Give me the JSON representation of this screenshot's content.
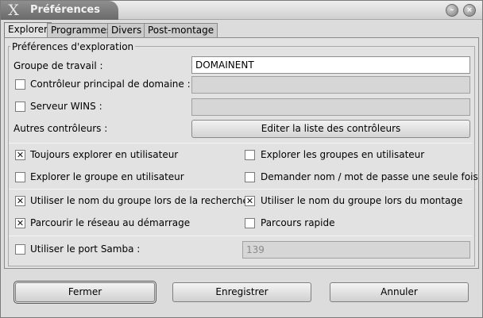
{
  "window": {
    "title": "Préférences",
    "icon": "x-icon",
    "controls": [
      "minimize-icon",
      "close-icon"
    ]
  },
  "tabs": [
    {
      "label": "Explorer",
      "active": true
    },
    {
      "label": "Programmes",
      "active": false
    },
    {
      "label": "Divers",
      "active": false
    },
    {
      "label": "Post-montage",
      "active": false
    }
  ],
  "group": {
    "title": "Préférences d'exploration"
  },
  "workgroup": {
    "label": "Groupe de travail :",
    "value": "DOMAINENT"
  },
  "pdc": {
    "label": "Contrôleur principal de domaine :",
    "checked": false,
    "value": ""
  },
  "wins": {
    "label": "Serveur WINS :",
    "checked": false,
    "value": ""
  },
  "other_controllers": {
    "label": "Autres contrôleurs :",
    "button": "Editer la liste des contrôleurs"
  },
  "options": {
    "always_browse_user": {
      "label": "Toujours explorer en utilisateur",
      "checked": true
    },
    "browse_groups_user": {
      "label": "Explorer les groupes en utilisateur",
      "checked": false
    },
    "browse_group_user": {
      "label": "Explorer le groupe en utilisateur",
      "checked": false
    },
    "ask_password_once": {
      "label": "Demander nom / mot de passe une seule fois",
      "checked": false
    },
    "use_group_name_search": {
      "label": "Utiliser le nom du groupe lors de la recherche",
      "checked": true
    },
    "use_group_name_mount": {
      "label": "Utiliser le nom du groupe lors du montage",
      "checked": true
    },
    "scan_network_startup": {
      "label": "Parcourir le réseau au démarrage",
      "checked": true
    },
    "quick_scan": {
      "label": "Parcours rapide",
      "checked": false
    }
  },
  "samba_port": {
    "label": "Utiliser le port Samba :",
    "checked": false,
    "value": "139"
  },
  "footer": {
    "close": "Fermer",
    "save": "Enregistrer",
    "cancel": "Annuler"
  }
}
